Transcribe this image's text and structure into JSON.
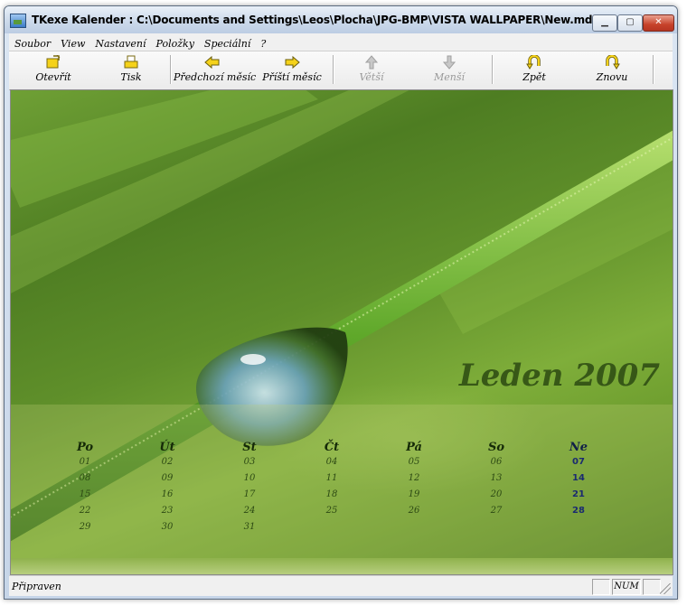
{
  "window": {
    "title": "TKexe Kalender : C:\\Documents and Settings\\Leos\\Plocha\\JPG-BMP\\VISTA WALLPAPER\\New.mdb",
    "min_glyph": "▁",
    "max_glyph": "▢",
    "close_glyph": "✕"
  },
  "menu": [
    "Soubor",
    "View",
    "Nastavení",
    "Položky",
    "Speciální",
    "?"
  ],
  "toolbar": {
    "open": "Otevřít",
    "print": "Tisk",
    "prev_month": "Předchozí měsíc",
    "next_month": "Příští měsíc",
    "bigger": "Větší",
    "smaller": "Menší",
    "undo": "Zpět",
    "redo": "Znovu"
  },
  "calendar": {
    "month_title": "Leden 2007",
    "day_names": [
      "Po",
      "Út",
      "St",
      "Čt",
      "Pá",
      "So",
      "Ne"
    ],
    "weeks": [
      [
        "01",
        "02",
        "03",
        "04",
        "05",
        "06",
        "07"
      ],
      [
        "08",
        "09",
        "10",
        "11",
        "12",
        "13",
        "14"
      ],
      [
        "15",
        "16",
        "17",
        "18",
        "19",
        "20",
        "21"
      ],
      [
        "22",
        "23",
        "24",
        "25",
        "26",
        "27",
        "28"
      ],
      [
        "29",
        "30",
        "31",
        "",
        "",
        "",
        ""
      ]
    ]
  },
  "status": {
    "text": "Připraven",
    "num": "NUM"
  },
  "icons": {
    "open": "open-folder-icon",
    "print": "printer-icon",
    "prev": "arrow-left-icon",
    "next": "arrow-right-icon",
    "bigger": "arrow-up-icon",
    "smaller": "arrow-down-icon",
    "undo": "undo-icon",
    "redo": "redo-icon"
  },
  "colors": {
    "accent_yellow": "#f5d21a",
    "sunday": "#1a2a70"
  }
}
